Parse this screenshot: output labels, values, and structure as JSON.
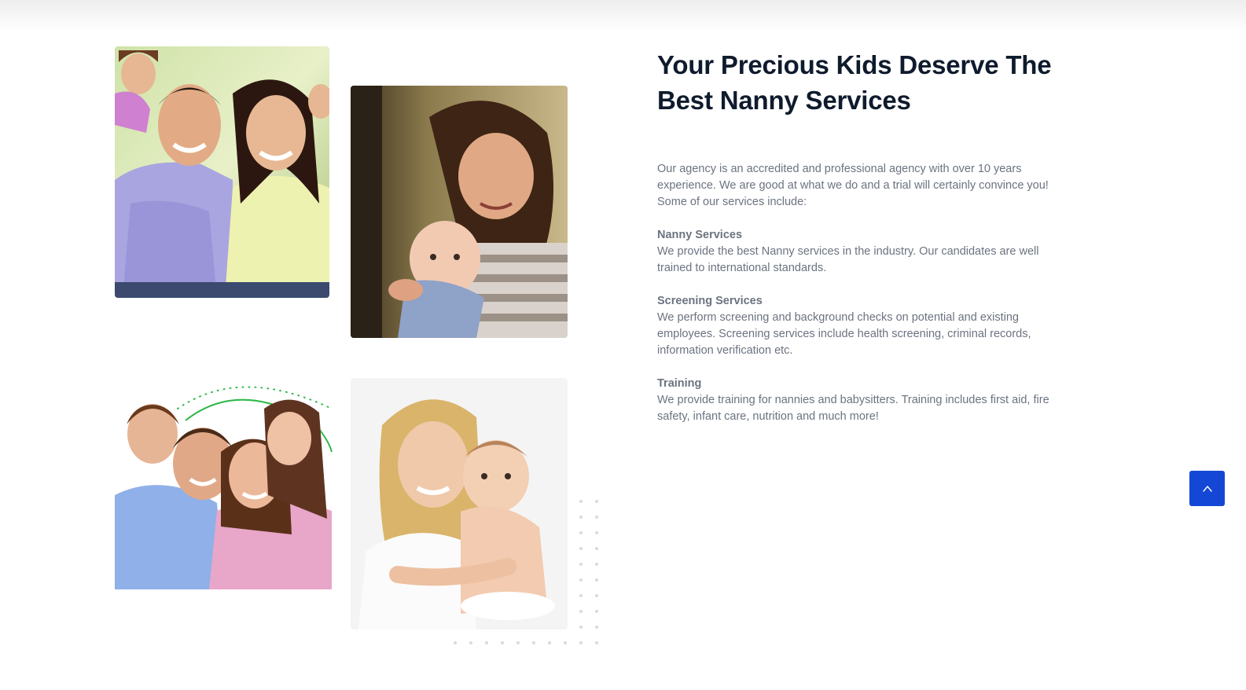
{
  "about": {
    "title": "Your Precious Kids Deserve The Best Nanny Services",
    "intro": "Our agency is an accredited and professional agency with over 10 years experience. We are good at what we do and a trial will certainly convince you! Some of our services include:",
    "services": [
      {
        "title": "Nanny Services",
        "description": "We provide the best Nanny services in the industry. Our candidates are well trained to international standards."
      },
      {
        "title": "Screening Services",
        "description": "We perform screening and background checks on potential and existing employees. Screening services include health screening, criminal records, information verification etc."
      },
      {
        "title": "Training",
        "description": "We provide training for nannies and babysitters. Training includes first aid, fire safety, infant care, nutrition and much more!"
      }
    ]
  },
  "gallery": [
    {
      "name": "family-photo-piggyback"
    },
    {
      "name": "mother-baby-photo"
    },
    {
      "name": "family-photo-four"
    },
    {
      "name": "mother-baby-white-photo"
    }
  ],
  "scroll_top": {
    "icon": "chevron-up-icon"
  },
  "colors": {
    "title": "#0f1b2d",
    "body_text": "#6b7380",
    "accent": "#1547d6",
    "arc_green": "#2fb84a"
  }
}
